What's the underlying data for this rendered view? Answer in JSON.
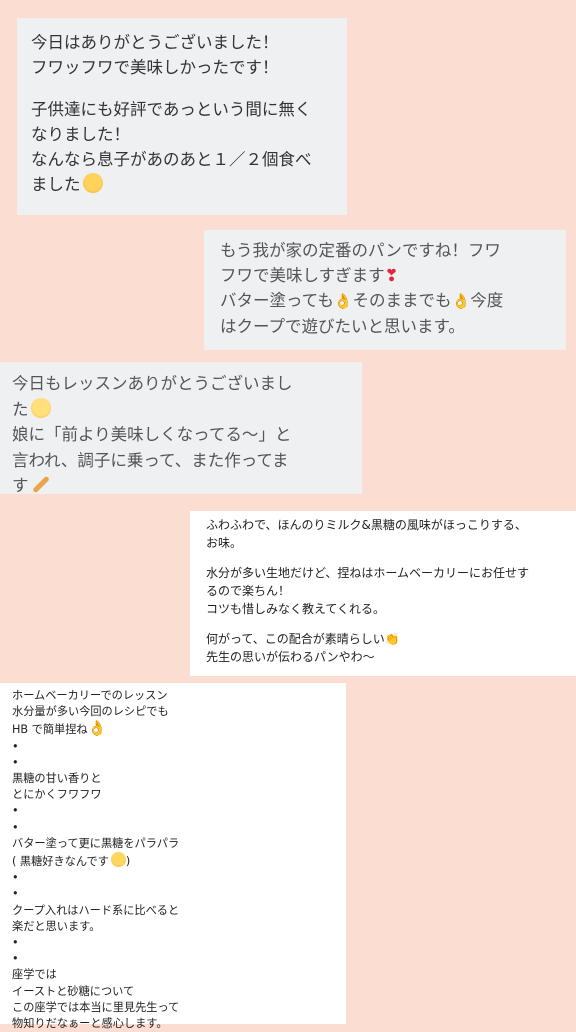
{
  "msg1": {
    "lines": [
      "今日はありがとうございました！",
      "フワッフワで美味しかったです！",
      "",
      "子供達にも好評であっという間に無く",
      "なりました！",
      "なんなら息子があのあと１／２個食べ",
      "ました"
    ],
    "emoji": "rolling-on-floor-laughing"
  },
  "msg2": {
    "l1": "もう我が家の定番のパンですね！フワ",
    "l2": "フワで美味しすぎます",
    "l2_mark": "❣",
    "l3a": "バター塗っても",
    "l3b": "そのままでも",
    "l3c": "今度",
    "ok_glyph": "👌",
    "l4": "はクープで遊びたいと思います。"
  },
  "msg3": {
    "l1": "今日もレッスンありがとうございまし",
    "l2": "た",
    "l3": "娘に「前より美味しくなってる〜」と",
    "l4": "言われ、調子に乗って、また作ってま",
    "l5": "す",
    "emoji_smile": "smiling-face",
    "emoji_end": "baguette"
  },
  "post1": {
    "lines": [
      "ふわふわで、ほんのりミルク&黒糖の風味がほっこりする、",
      "お味。",
      "",
      "水分が多い生地だけど、捏ねはホームベーカリーにお任せす",
      "るので楽ちん！",
      "コツも惜しみなく教えてくれる。",
      "",
      "何がって、この配合が素晴らしい",
      "先生の思いが伝わるパンやわ〜"
    ],
    "clap_glyph": "👏"
  },
  "post2": {
    "lines": [
      "ホームベーカリーでのレッスン",
      "水分量が多い今回のレシピでも",
      "HB で簡単捏ね",
      "•",
      "•",
      "黒糖の甘い香りと",
      "とにかくフワフワ",
      "•",
      "•",
      "バター塗って更に黒糖をパラパラ",
      "( 黒糖好きなんです",
      "•",
      "•",
      "クープ入れはハード系に比べると",
      "楽だと思います。",
      "•",
      "•",
      "座学では",
      "イーストと砂糖について",
      "この座学では本当に里見先生って",
      "物知りだなぁーと感心します。"
    ],
    "ok_glyph": "👌",
    "close_paren": ")"
  }
}
